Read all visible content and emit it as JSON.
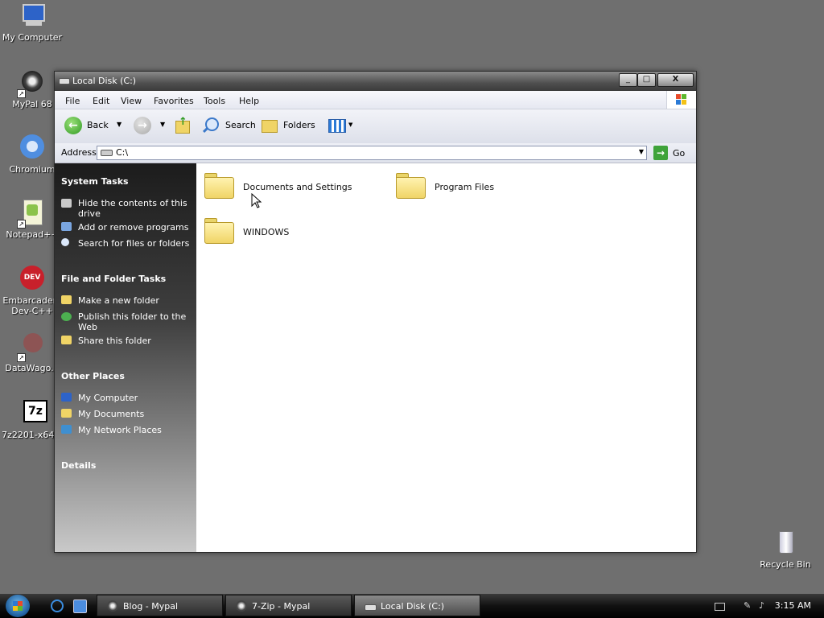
{
  "desktop": {
    "icons": [
      {
        "label": "My Computer"
      },
      {
        "label": "MyPal 68"
      },
      {
        "label": "Chromium"
      },
      {
        "label": "Notepad++"
      },
      {
        "label": "Embarcadero Dev-C++"
      },
      {
        "label": "DataWago..."
      },
      {
        "label": "7z2201-x64..."
      },
      {
        "label": "Recycle Bin"
      }
    ],
    "dev_badge": "DEV",
    "sevenzip_badge": "7z"
  },
  "window": {
    "title": "Local Disk (C:)",
    "buttons": {
      "minimize": "_",
      "maximize": "□",
      "close": "X"
    },
    "menu": [
      "File",
      "Edit",
      "View",
      "Favorites",
      "Tools",
      "Help"
    ],
    "toolbar": {
      "back": "Back",
      "search": "Search",
      "folders": "Folders"
    },
    "address": {
      "label": "Address",
      "value": "C:\\",
      "go": "Go"
    },
    "left_pane": {
      "system_tasks": {
        "title": "System Tasks",
        "items": [
          "Hide the contents of this drive",
          "Add or remove programs",
          "Search for files or folders"
        ]
      },
      "file_folder_tasks": {
        "title": "File and Folder Tasks",
        "items": [
          "Make a new folder",
          "Publish this folder to the Web",
          "Share this folder"
        ]
      },
      "other_places": {
        "title": "Other Places",
        "items": [
          "My Computer",
          "My Documents",
          "My Network Places"
        ]
      },
      "details": {
        "title": "Details"
      }
    },
    "folders": [
      {
        "name": "Documents and Settings"
      },
      {
        "name": "Program Files"
      },
      {
        "name": "WINDOWS"
      }
    ]
  },
  "taskbar": {
    "tasks": [
      {
        "label": "Blog - Mypal"
      },
      {
        "label": "7-Zip - Mypal"
      },
      {
        "label": "Local Disk (C:)"
      }
    ],
    "clock": "3:15 AM"
  }
}
